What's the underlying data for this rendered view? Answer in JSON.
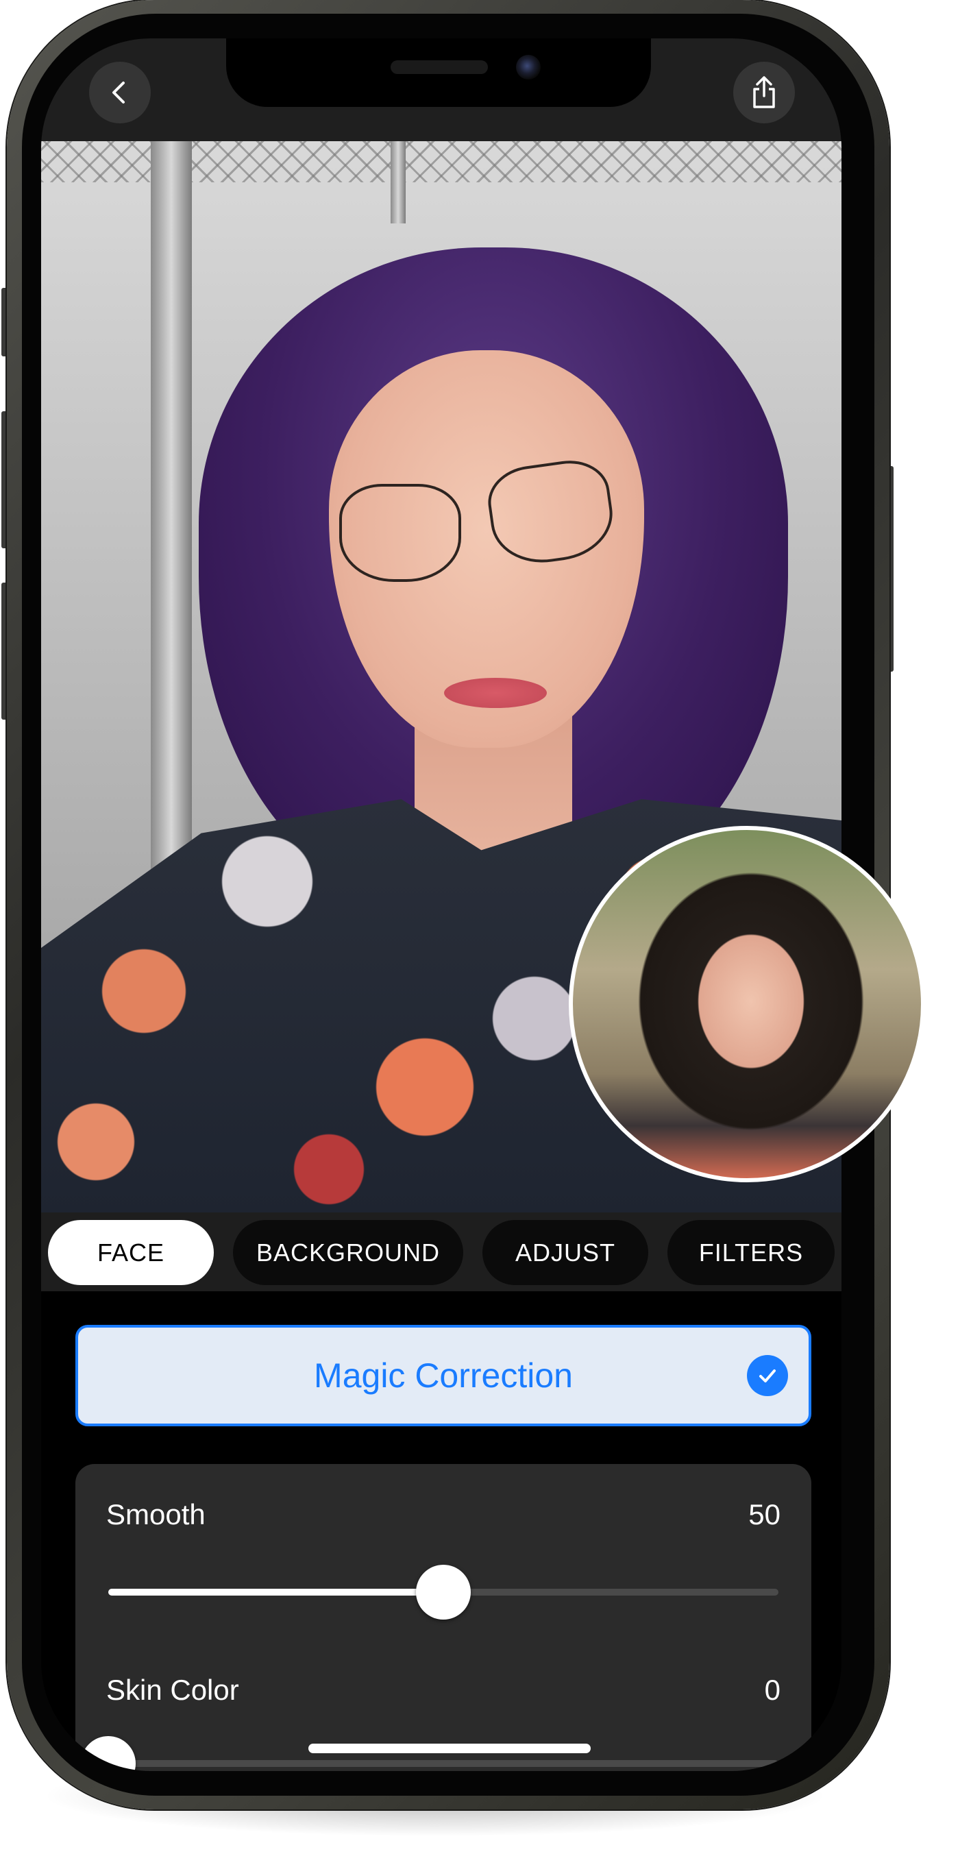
{
  "toolbar": {
    "back_icon": "chevron-left-icon",
    "share_icon": "share-icon"
  },
  "photo": {
    "description_tag": "portrait-photo",
    "inset_tag": "original-photo-preview"
  },
  "tabs": [
    {
      "label": "FACE",
      "active": true
    },
    {
      "label": "BACKGROUND",
      "active": false
    },
    {
      "label": "ADJUST",
      "active": false
    },
    {
      "label": "FILTERS",
      "active": false
    }
  ],
  "magic_correction": {
    "label": "Magic Correction",
    "checked": true
  },
  "sliders": [
    {
      "label": "Smooth",
      "value": "50",
      "fraction": 0.5
    },
    {
      "label": "Skin Color",
      "value": "0",
      "fraction": 0.0
    }
  ],
  "colors": {
    "accent": "#1a7cff",
    "tab_active_bg": "#ffffff",
    "tab_bg": "#0b0b0b",
    "panel_bg": "#2b2b2b",
    "magic_bg": "#e3ebf6"
  }
}
